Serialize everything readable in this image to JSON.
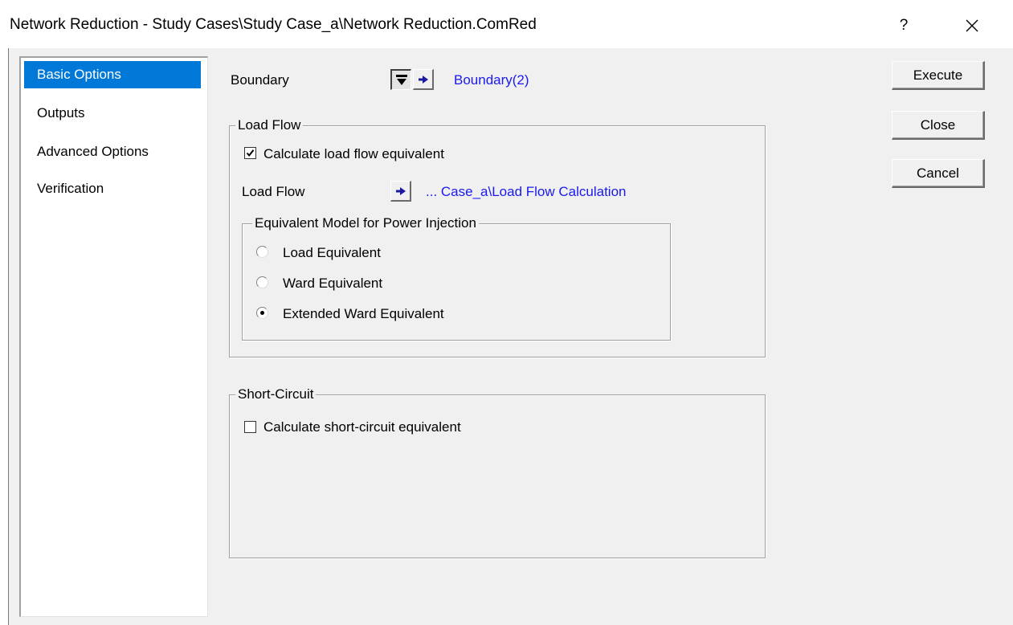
{
  "window": {
    "title": "Network Reduction - Study Cases\\Study Case_a\\Network Reduction.ComRed",
    "help_label": "?"
  },
  "nav": {
    "items": [
      {
        "label": "Basic Options",
        "selected": true
      },
      {
        "label": "Outputs",
        "selected": false
      },
      {
        "label": "Advanced Options",
        "selected": false
      },
      {
        "label": "Verification",
        "selected": false
      }
    ]
  },
  "boundary": {
    "label": "Boundary",
    "link": "Boundary(2)"
  },
  "load_flow": {
    "group_label": "Load Flow",
    "checkbox_label": "Calculate load flow equivalent",
    "checked": true,
    "field_label": "Load Flow",
    "link": "... Case_a\\Load Flow Calculation",
    "equivalent": {
      "group_label": "Equivalent Model for Power Injection",
      "options": [
        {
          "label": "Load Equivalent",
          "selected": false
        },
        {
          "label": "Ward Equivalent",
          "selected": false
        },
        {
          "label": "Extended Ward Equivalent",
          "selected": true
        }
      ]
    }
  },
  "short_circuit": {
    "group_label": "Short-Circuit",
    "checkbox_label": "Calculate short-circuit equivalent",
    "checked": false
  },
  "buttons": {
    "execute": "Execute",
    "close": "Close",
    "cancel": "Cancel"
  },
  "colors": {
    "selection": "#0078d7",
    "link": "#1a1aee",
    "dialog_bg": "#f0f0f0"
  }
}
